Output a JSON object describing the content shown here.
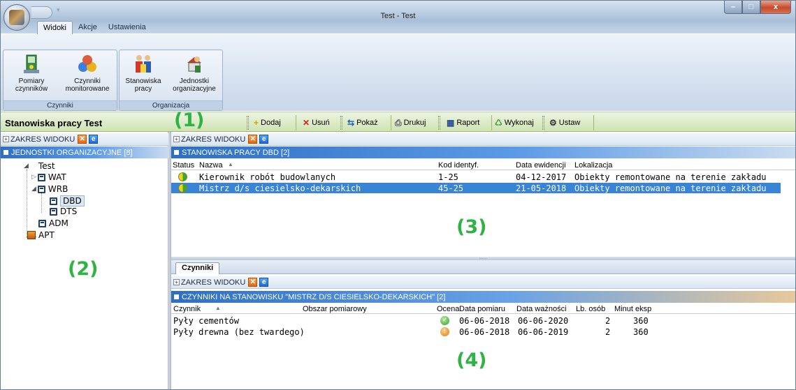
{
  "window": {
    "title": "Test - Test",
    "controls": {
      "minimize": "–",
      "maximize": "□",
      "close": "x"
    }
  },
  "ribbon": {
    "tabs": [
      {
        "label": "Widoki"
      },
      {
        "label": "Akcje"
      },
      {
        "label": "Ustawienia"
      }
    ],
    "groups": [
      {
        "label": "Czynniki",
        "buttons": [
          {
            "label": "Pomiary czynników"
          },
          {
            "label": "Czynniki monitorowane"
          }
        ]
      },
      {
        "label": "Organizacja",
        "buttons": [
          {
            "label": "Stanowiska pracy"
          },
          {
            "label": "Jednostki organizacyjne"
          }
        ]
      }
    ]
  },
  "left": {
    "title": "Stanowiska pracy Test",
    "zakres": "ZAKRES WIDOKU",
    "section": "JEDNOSTKI ORGANIZACYJNE [8]",
    "tree": [
      {
        "label": "Test"
      },
      {
        "label": "WAT"
      },
      {
        "label": "WRB"
      },
      {
        "label": "DBD"
      },
      {
        "label": "DTS"
      },
      {
        "label": "ADM"
      },
      {
        "label": "APT"
      }
    ]
  },
  "toolbar": {
    "add": "Dodaj",
    "remove": "Usuń",
    "show": "Pokaż",
    "print": "Drukuj",
    "report": "Raport",
    "execute": "Wykonaj",
    "settings": "Ustaw"
  },
  "upper": {
    "zakres": "ZAKRES WIDOKU",
    "section": "STANOWISKA PRACY DBD [2]",
    "columns": [
      "Status",
      "Nazwa",
      "Kod identyf.",
      "Data ewidencji",
      "Lokalizacja"
    ],
    "rows": [
      {
        "name": "Kierownik robót budowlanych",
        "code": "1-25",
        "date": "04-12-2017",
        "location": "Obiekty remontowane na terenie zakładu"
      },
      {
        "name": "Mistrz d/s ciesielsko-dekarskich",
        "code": "45-25",
        "date": "21-05-2018",
        "location": "Obiekty remontowane na terenie zakładu"
      }
    ]
  },
  "lower": {
    "tab": "Czynniki",
    "zakres": "ZAKRES WIDOKU",
    "section": "CZYNNIKI NA STANOWISKU \"MISTRZ D/S CIESIELSKO-DEKARSKICH\" [2]",
    "columns": [
      "Czynnik",
      "Obszar pomiarowy",
      "Ocena",
      "Data pomiaru",
      "Data ważności",
      "Lb. osób",
      "Minut eksp"
    ],
    "rows": [
      {
        "factor": "Pyły cementów",
        "area": "",
        "measured": "06-06-2018",
        "valid": "06-06-2020",
        "persons": "2",
        "minutes": "360",
        "rating": "ok"
      },
      {
        "factor": "Pyły drewna (bez twardego)",
        "area": "",
        "measured": "06-06-2018",
        "valid": "06-06-2019",
        "persons": "2",
        "minutes": "360",
        "rating": "warning"
      }
    ]
  },
  "annotations": [
    "(1)",
    "(2)",
    "(3)",
    "(4)"
  ]
}
